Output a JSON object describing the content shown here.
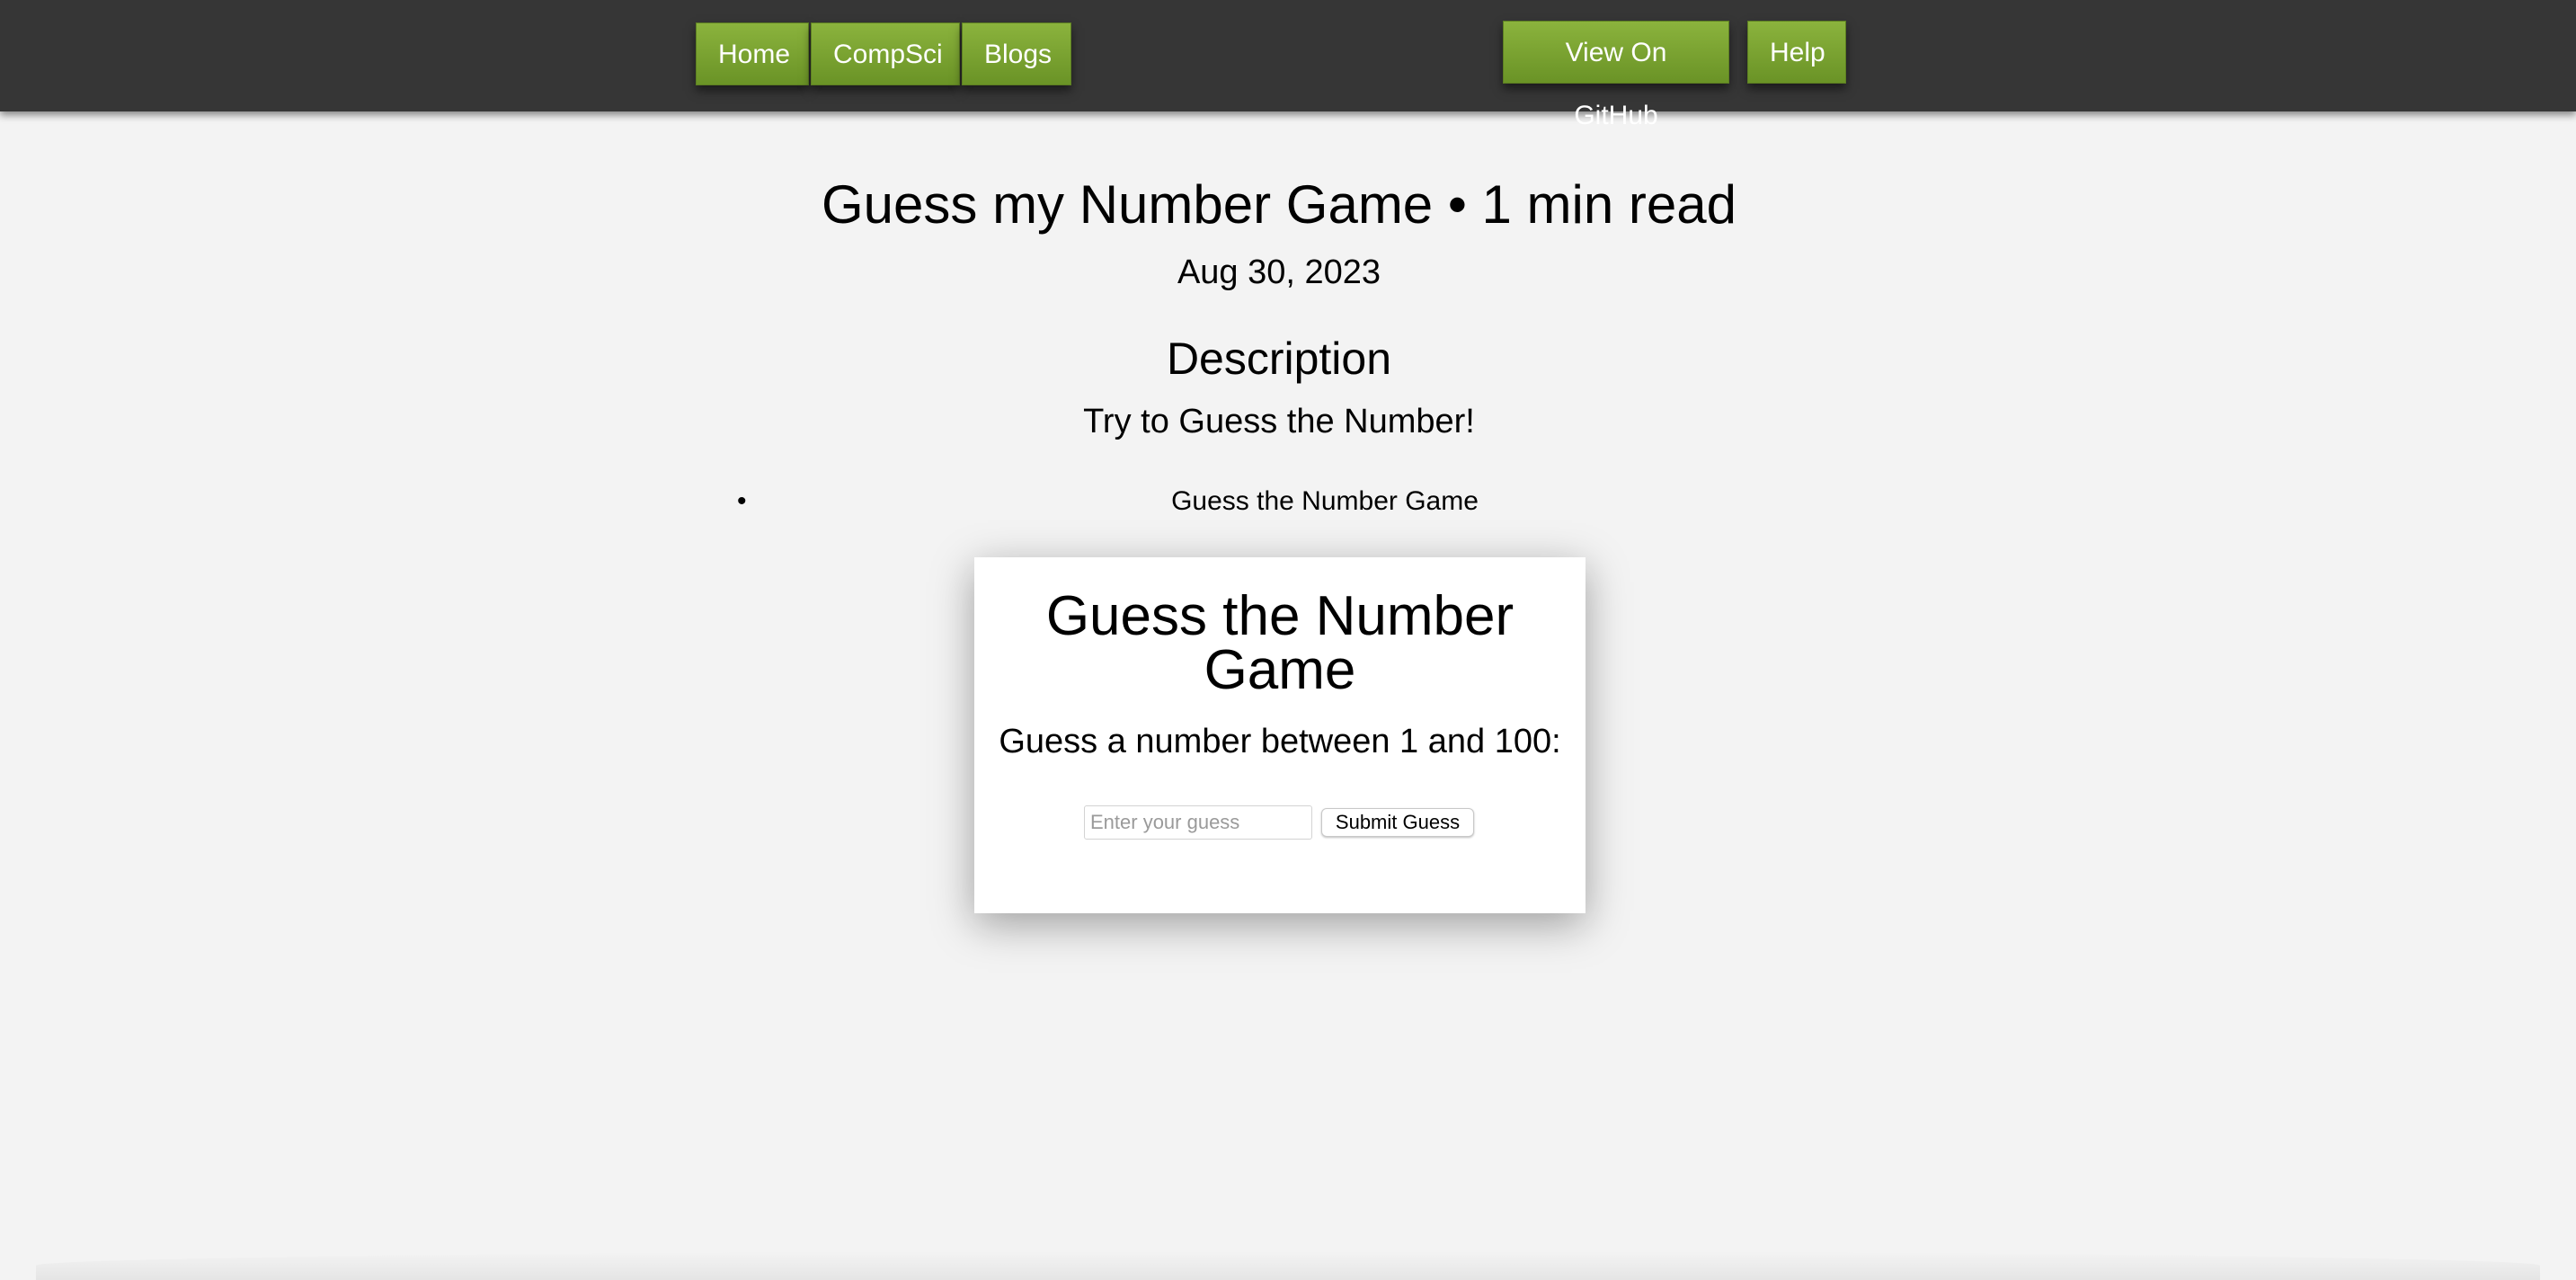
{
  "nav": {
    "home": "Home",
    "compsci": "CompSci",
    "blogs": "Blogs",
    "github": "View On GitHub",
    "help": "Help"
  },
  "post": {
    "title": "Guess my Number Game • 1 min read",
    "date": "Aug 30, 2023",
    "description_heading": "Description",
    "description_text": "Try to Guess the Number!",
    "list_items": [
      "Guess the Number Game"
    ]
  },
  "game": {
    "title": "Guess the Number Game",
    "prompt": "Guess a number between 1 and 100:",
    "input_placeholder": "Enter your guess",
    "input_value": "",
    "submit_label": "Submit Guess"
  },
  "colors": {
    "topbar": "#363636",
    "nav_button": "#7ba431",
    "page_background": "#f3f3f3",
    "card_background": "#ffffff"
  }
}
